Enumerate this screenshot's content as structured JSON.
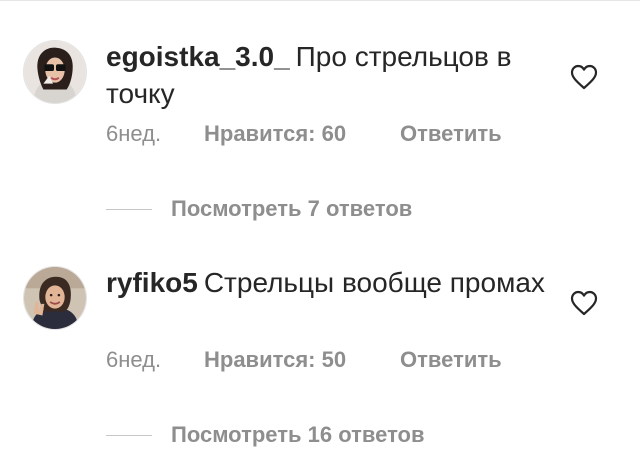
{
  "comments": [
    {
      "username": "egoistka_3.0_",
      "text": "Про стрельцов в точку",
      "age": "6нед.",
      "likes": "Нравится: 60",
      "reply": "Ответить",
      "view_replies": "Посмотреть 7 ответов",
      "avatar_icon": "avatar-photo-woman-sunglasses"
    },
    {
      "username": "ryfiko5",
      "text": "Стрельцы вообще промах",
      "age": "6нед.",
      "likes": "Нравится: 50",
      "reply": "Ответить",
      "view_replies": "Посмотреть 16 ответов",
      "avatar_icon": "avatar-photo-woman-peace-sign"
    }
  ],
  "colors": {
    "primary_text": "#262626",
    "secondary_text": "#8e8e8e",
    "divider": "#c7c7c7"
  }
}
